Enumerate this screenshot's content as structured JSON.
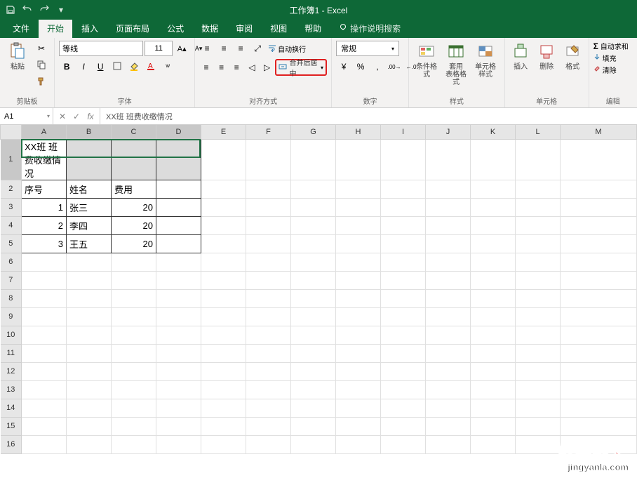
{
  "titlebar": {
    "title": "工作簿1 - Excel"
  },
  "tabs": {
    "items": [
      "文件",
      "开始",
      "插入",
      "页面布局",
      "公式",
      "数据",
      "审阅",
      "视图",
      "帮助"
    ],
    "tellme": "操作说明搜索",
    "activeIndex": 1
  },
  "ribbon": {
    "clipboard": {
      "paste": "粘贴",
      "label": "剪贴板"
    },
    "font": {
      "name": "等线",
      "size": "11",
      "label": "字体"
    },
    "alignment": {
      "wrap": "自动换行",
      "merge": "合并后居中",
      "label": "对齐方式"
    },
    "number": {
      "format": "常规",
      "label": "数字"
    },
    "styles": {
      "cond": "条件格式",
      "table": "套用\n表格格式",
      "cell": "单元格样式",
      "label": "样式"
    },
    "cells": {
      "insert": "插入",
      "delete": "删除",
      "format": "格式",
      "label": "单元格"
    },
    "editing": {
      "sum": "自动求和",
      "fill": "填充",
      "clear": "清除",
      "label": "编辑"
    }
  },
  "formula_bar": {
    "ref": "A1",
    "text": "XX班 班费收缴情况"
  },
  "grid": {
    "cols": [
      "A",
      "B",
      "C",
      "D",
      "E",
      "F",
      "G",
      "H",
      "I",
      "J",
      "K",
      "L",
      "M"
    ],
    "rows": [
      "1",
      "2",
      "3",
      "4",
      "5",
      "6",
      "7",
      "8",
      "9",
      "10",
      "11",
      "12",
      "13",
      "14",
      "15",
      "16"
    ],
    "data": {
      "A1": "XX班 班费收缴情况",
      "A2": "序号",
      "B2": "姓名",
      "C2": "费用",
      "A3": "1",
      "B3": "张三",
      "C3": "20",
      "A4": "2",
      "B4": "李四",
      "C4": "20",
      "A5": "3",
      "B5": "王五",
      "C5": "20"
    }
  },
  "watermark": {
    "text": "经验啦",
    "url": "jingyanla.com"
  }
}
